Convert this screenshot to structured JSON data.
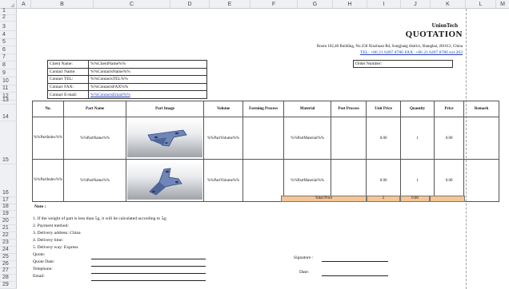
{
  "columns": [
    "A",
    "B",
    "C",
    "D",
    "E",
    "F",
    "G",
    "H",
    "I",
    "J",
    "K",
    "L",
    "M"
  ],
  "rows": [
    "1",
    "2",
    "3",
    "4",
    "5",
    "6",
    "7",
    "8",
    "9",
    "10",
    "11",
    "12",
    "13",
    "14",
    "15",
    "16",
    "17",
    "18",
    "19",
    "20",
    "21",
    "22",
    "23",
    "24",
    "25",
    "26",
    "27",
    "28",
    "29"
  ],
  "header": {
    "brand": "UnionTech",
    "title": "QUOTATION",
    "address": "Room 102,40 Building, No.258 Xinzhuan Rd, Songjiang district, Shanghai, 201612, China",
    "phones": "TEL: +86 21 6497 8786  FAX: +86 21 6497 8786 ext.202"
  },
  "client_info": [
    {
      "label": "Client Name:",
      "value": "%%ClientName%%"
    },
    {
      "label": "Contact Name:",
      "value": "%%ContactsName%%"
    },
    {
      "label": "Contact TEL:",
      "value": "%%ContactsTEL%%"
    },
    {
      "label": "Contact FAX:",
      "value": "%%ContactsFAX%%"
    },
    {
      "label": "Contact E-mail:",
      "value": "%%ContactsEmail%%"
    }
  ],
  "order_number_label": "Order Number:",
  "table": {
    "headers": [
      "No.",
      "Part Name",
      "Part Image",
      "Volume",
      "Forming Process",
      "Material",
      "Post Process",
      "Unit Price",
      "Quantity",
      "Price",
      "Remark"
    ],
    "rows": [
      {
        "no": "%%PartIndex%%",
        "name": "%%PartName%%",
        "image": "bracket-part-image",
        "volume": "%%PartVolume%%",
        "forming": "",
        "material": "%%PartMaterial%%",
        "post": "",
        "unit_price": "0.00",
        "quantity": "1",
        "price": "0.00",
        "remark": ""
      },
      {
        "no": "%%PartIndex%%",
        "name": "%%PartName%%",
        "image": "clamp-part-image",
        "volume": "%%PartVolume%%",
        "forming": "",
        "material": "%%PartMaterial%%",
        "post": "",
        "unit_price": "0.00",
        "quantity": "1",
        "price": "0.00",
        "remark": ""
      }
    ]
  },
  "totals": {
    "label": "Total Price",
    "quantity": "2",
    "price": "0.00"
  },
  "notes": {
    "title": "Note :",
    "items": [
      "1. If the weight of part is less than 5g, it will be calculated according to 5g;",
      "2. Payment method:",
      "3. Delivery address: China",
      "4. Delivery time:",
      "5. Delivery way: Express"
    ],
    "fields": [
      "Quote:",
      "Quote Date:",
      "Telephone:",
      "Email:"
    ],
    "signature_label": "Signature :",
    "date_label": "Date:"
  },
  "colors": {
    "total_fill": "#f5c596",
    "link_blue": "#1f3fbf",
    "header_gray": "#eef0f3"
  }
}
